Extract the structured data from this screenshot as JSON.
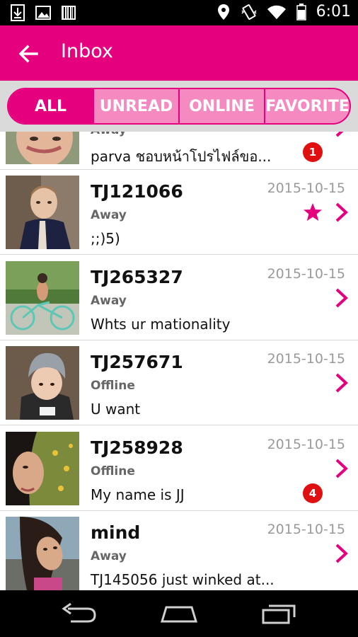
{
  "status_bar": {
    "time": "6:01",
    "icons": [
      "download-icon",
      "image-icon",
      "barcode-icon",
      "location-icon",
      "vibrate-icon",
      "wifi-icon",
      "battery-icon"
    ]
  },
  "app_bar": {
    "title": "Inbox",
    "color": "#e5007e",
    "back_icon": "arrow-back-icon"
  },
  "tabs": [
    {
      "label": "ALL",
      "active": true
    },
    {
      "label": "UNREAD",
      "active": false
    },
    {
      "label": "ONLINE",
      "active": false
    },
    {
      "label": "FAVORITE",
      "active": false
    }
  ],
  "conversations": [
    {
      "name": "",
      "date": "",
      "status": "Away",
      "message": "parva ชอบหน้าโปรไฟล์ขอ...",
      "badge": "1",
      "favorite": false
    },
    {
      "name": "TJ121066",
      "date": "2015-10-15",
      "status": "Away",
      "message": ";;)5)",
      "badge": "",
      "favorite": true
    },
    {
      "name": "TJ265327",
      "date": "2015-10-15",
      "status": "Away",
      "message": "Whts ur mationality",
      "badge": "",
      "favorite": false
    },
    {
      "name": "TJ257671",
      "date": "2015-10-15",
      "status": "Offline",
      "message": "U want",
      "badge": "",
      "favorite": false
    },
    {
      "name": "TJ258928",
      "date": "2015-10-15",
      "status": "Offline",
      "message": "My name is JJ",
      "badge": "4",
      "favorite": false
    },
    {
      "name": "mind",
      "date": "2015-10-15",
      "status": "Away",
      "message": "TJ145056 just winked at...",
      "badge": "",
      "favorite": false
    }
  ],
  "colors": {
    "accent": "#e5007e",
    "tab_inactive": "#f58ac0",
    "badge": "#e01010",
    "date_text": "#9a9a9a"
  },
  "nav_bar": {
    "buttons": [
      "back-nav-icon",
      "home-nav-icon",
      "recents-nav-icon"
    ]
  }
}
